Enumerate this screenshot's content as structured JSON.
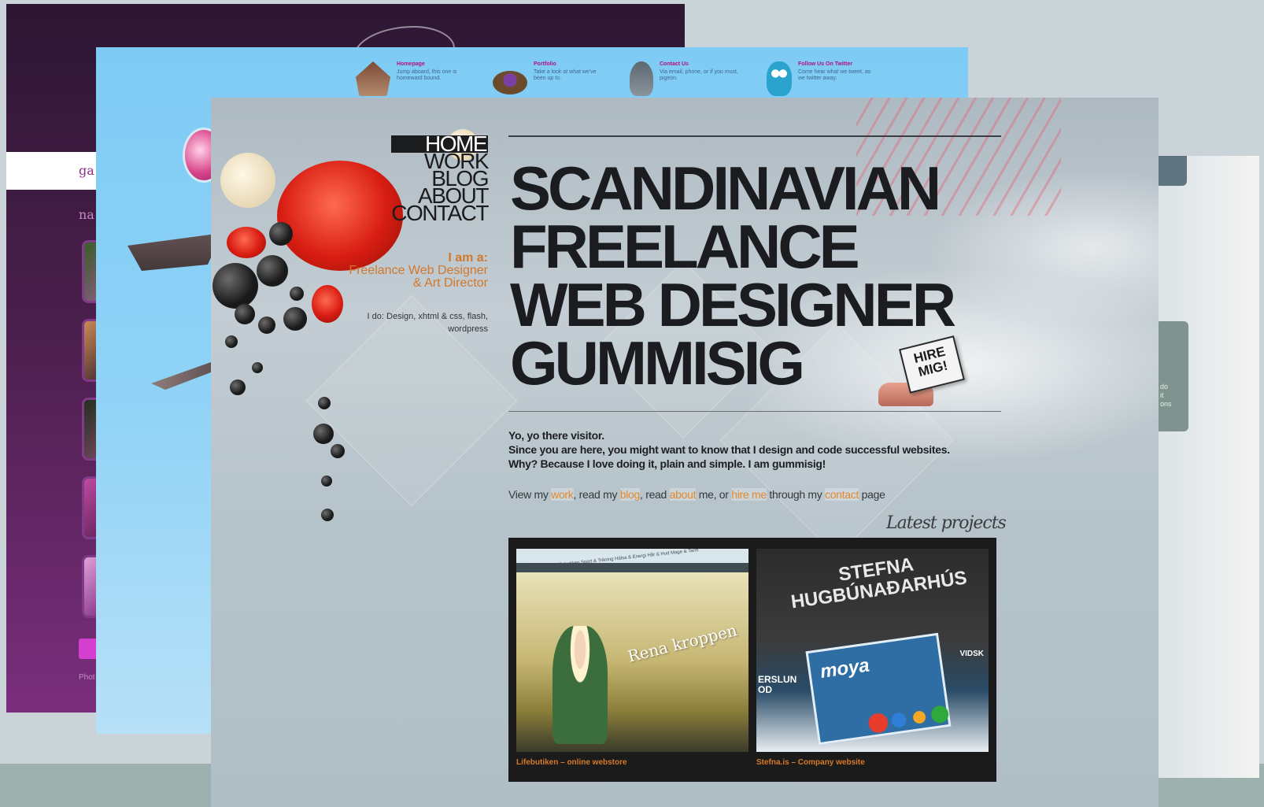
{
  "back_left_site": {
    "header_text": "ga",
    "subnav_text": "na",
    "footer_text": "Phot"
  },
  "back_right_site": {
    "side_text": "do\nit\nons"
  },
  "middle_site": {
    "nav": [
      {
        "title": "Homepage",
        "desc": "Jump aboard, this one is homeward bound.",
        "icon": "house-icon"
      },
      {
        "title": "Portfolio",
        "desc": "Take a look at what we've been up to.",
        "icon": "nest-icon"
      },
      {
        "title": "Contact Us",
        "desc": "Via email, phone, or if you must, pigeon.",
        "icon": "pigeon-icon"
      },
      {
        "title": "Follow Us On Twitter",
        "desc": "Come hear what we tweet, as we twitter away.",
        "icon": "owl-icon"
      }
    ]
  },
  "front_site": {
    "nav": [
      {
        "label": "HOME",
        "active": true
      },
      {
        "label": "WORK",
        "active": false
      },
      {
        "label": "BLOG",
        "active": false
      },
      {
        "label": "ABOUT",
        "active": false
      },
      {
        "label": "CONTACT",
        "active": false
      }
    ],
    "iam_lead": "I am a:",
    "iam_role": "Freelance Web Designer & Art Director",
    "ido": "I do: Design, xhtml & css, flash, wordpress",
    "headline": "SCANDINAVIAN\nFREELANCE\nWEB DESIGNER\nGUMMISIG",
    "hire_sign": "HIRE MIG!",
    "intro": [
      "Yo, yo there visitor.",
      "Since you are here, you might want to know that I design and code successful websites.",
      "Why? Because I love doing it, plain and simple. I am gummisig!"
    ],
    "cta": {
      "t1": "View my ",
      "l1": "work",
      "t2": ", read my ",
      "l2": "blog",
      "t3": ", read ",
      "l3": "about",
      "t4": " me, or ",
      "l4": "hire me",
      "t5": " through my ",
      "l5": "contact",
      "t6": " page"
    },
    "latest_heading": "Latest projects",
    "projects": [
      {
        "caption": "Lifebutiken – online webstore",
        "shot_title": "Rena kroppen",
        "shot_tabs": "Kost & Kost   Lifebutiken   Sport & Träning   Hälsa & Energi   Hår & Hud   Mage & Tarm"
      },
      {
        "caption": "Stefna.is – Company website",
        "shot_brand": "STEFNA HUGBÚNAÐARHÚS",
        "shot_product": "moya",
        "shot_side": "ERSLUN\nOD",
        "shot_right": "VIDSK"
      }
    ]
  },
  "colors": {
    "accent_orange": "#e38a2e",
    "headline_ink": "#1a1c1f",
    "purple_site": "#4a1f4c",
    "sky_site": "#7ecbf5"
  }
}
